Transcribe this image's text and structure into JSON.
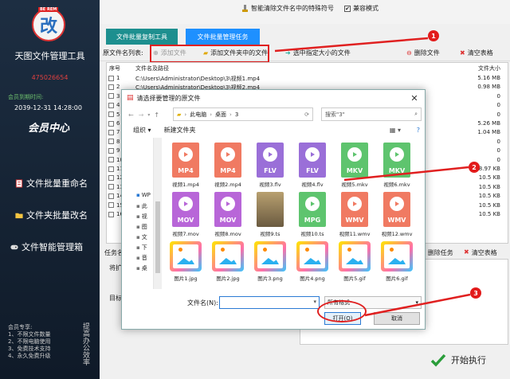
{
  "sidebar": {
    "logo_char": "改",
    "logo_tag": "BE REM",
    "app_name": "天图文件管理工具",
    "qq": "475026654",
    "expiry_label": "会员到期时间:",
    "expiry_date": "2039-12-31 14:28:00",
    "member_center": "会员中心",
    "items": [
      {
        "label": "文件批量重命名"
      },
      {
        "label": "文件夹批量改名"
      },
      {
        "label": "文件智能管理箱"
      }
    ],
    "notes": [
      "会员专享:",
      "1、不限文件数量",
      "2、不限电脑使用",
      "3、免费技术支持",
      "4、永久免费升级"
    ],
    "vertical_text": "提高办公效率"
  },
  "topbar": {
    "clear_special": "智能清除文件名中的特殊符号",
    "compat_mode": "兼容模式"
  },
  "tabs": [
    {
      "label": "文件批量复制工具"
    },
    {
      "label": "文件批量管理任务"
    }
  ],
  "toolbar": {
    "list_label": "原文件名列表:",
    "add_file": "添加文件",
    "add_folder_files": "添加文件夹中的文件",
    "select_size": "选中指定大小的文件",
    "delete_file": "删除文件",
    "clear_table": "清空表格"
  },
  "list": {
    "col_no": "序号",
    "col_name": "文件名及路径",
    "col_size": "文件大小",
    "rows": [
      {
        "no": "1",
        "path": "C:\\Users\\Administrator\\Desktop\\3\\视频1.mp4",
        "size": "5.16 MB"
      },
      {
        "no": "2",
        "path": "C:\\Users\\Administrator\\Desktop\\3\\视频2.mp4",
        "size": "0.98 MB"
      },
      {
        "no": "3",
        "path": "C:\\Users\\Administrator\\Desktop\\3\\视频3.flv",
        "size": "0"
      },
      {
        "no": "4",
        "path": "",
        "size": "0"
      },
      {
        "no": "5",
        "path": "",
        "size": "0"
      },
      {
        "no": "6",
        "path": "",
        "size": "5.26 MB"
      },
      {
        "no": "7",
        "path": "",
        "size": "1.04 MB"
      },
      {
        "no": "8",
        "path": "",
        "size": "0"
      },
      {
        "no": "9",
        "path": "",
        "size": "0"
      },
      {
        "no": "10",
        "path": "",
        "size": "0"
      },
      {
        "no": "11",
        "path": "",
        "size": "8.97 KB"
      },
      {
        "no": "12",
        "path": "",
        "size": "10.5 KB"
      },
      {
        "no": "13",
        "path": "",
        "size": "10.5 KB"
      },
      {
        "no": "14",
        "path": "",
        "size": "10.5 KB"
      },
      {
        "no": "15",
        "path": "",
        "size": "10.5 KB"
      },
      {
        "no": "16",
        "path": "",
        "size": "10.5 KB"
      }
    ]
  },
  "bottom": {
    "task_label": "任务名",
    "extend_label": "将扩",
    "target_label": "目标文",
    "delete_task": "删除任务",
    "clear_table": "清空表格",
    "start": "开始执行"
  },
  "dialog": {
    "title": "请选择要管理的原文件",
    "path": [
      "此电脑",
      "桌面",
      "3"
    ],
    "search_placeholder": "搜索\"3\"",
    "organize": "组织",
    "new_folder": "新建文件夹",
    "nav": [
      "WP",
      "此",
      "视",
      "图",
      "文",
      "下",
      "音",
      "桌"
    ],
    "files": [
      {
        "name": "视频1.mp4",
        "ext": "MP4",
        "color": "#f07a62"
      },
      {
        "name": "视频2.mp4",
        "ext": "MP4",
        "color": "#f07a62"
      },
      {
        "name": "视频3.flv",
        "ext": "FLV",
        "color": "#9a6fd8"
      },
      {
        "name": "视频4.flv",
        "ext": "FLV",
        "color": "#9a6fd8"
      },
      {
        "name": "视频5.mkv",
        "ext": "MKV",
        "color": "#5ec46e"
      },
      {
        "name": "视频6.mkv",
        "ext": "MKV",
        "color": "#5ec46e"
      },
      {
        "name": "视频7.mov",
        "ext": "MOV",
        "color": "#b866d8"
      },
      {
        "name": "视频8.mov",
        "ext": "MOV",
        "color": "#b866d8"
      },
      {
        "name": "视频9.ts",
        "ext": "",
        "color": "#8a7a5a"
      },
      {
        "name": "视频10.ts",
        "ext": "MPG",
        "color": "#5ec46e"
      },
      {
        "name": "视频11.wmv",
        "ext": "WMV",
        "color": "#f07a62"
      },
      {
        "name": "视频12.wmv",
        "ext": "WMV",
        "color": "#f07a62"
      },
      {
        "name": "图片1.jpg"
      },
      {
        "name": "图片2.jpg"
      },
      {
        "name": "图片3.png"
      },
      {
        "name": "图片4.png"
      },
      {
        "name": "图片5.gif"
      },
      {
        "name": "图片6.gif"
      }
    ],
    "filename_label": "文件名(N):",
    "filetype": "所有格式",
    "open": "打开(O)",
    "cancel": "取消"
  },
  "badges": [
    "1",
    "2",
    "3"
  ]
}
